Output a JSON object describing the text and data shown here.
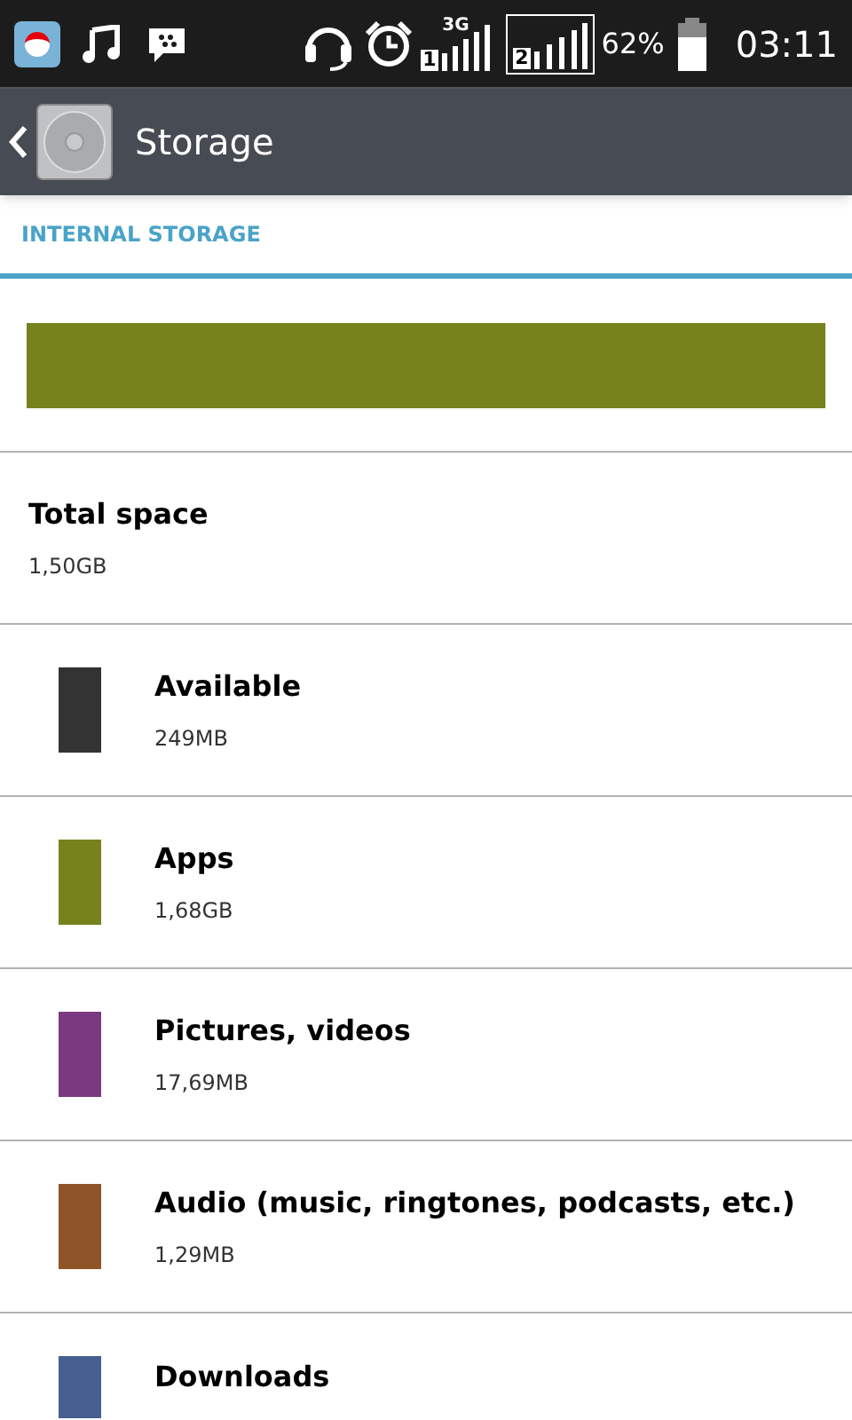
{
  "status_bar": {
    "sim1_network": "3G",
    "sim1_label": "1",
    "sim2_label": "2",
    "battery": "62%",
    "time": "03:11"
  },
  "toolbar": {
    "title": "Storage"
  },
  "section": {
    "title": "INTERNAL STORAGE"
  },
  "usage_bar": {
    "segments": [
      {
        "color": "#77821c"
      }
    ]
  },
  "total": {
    "label": "Total space",
    "value": "1,50GB"
  },
  "categories": [
    {
      "label": "Available",
      "value": "249MB",
      "color": "#333333"
    },
    {
      "label": "Apps",
      "value": "1,68GB",
      "color": "#77821c"
    },
    {
      "label": "Pictures, videos",
      "value": "17,69MB",
      "color": "#7b3a80"
    },
    {
      "label": "Audio (music, ringtones, podcasts, etc.)",
      "value": "1,29MB",
      "color": "#8e5428"
    },
    {
      "label": "Downloads",
      "color": "#465f90"
    }
  ]
}
